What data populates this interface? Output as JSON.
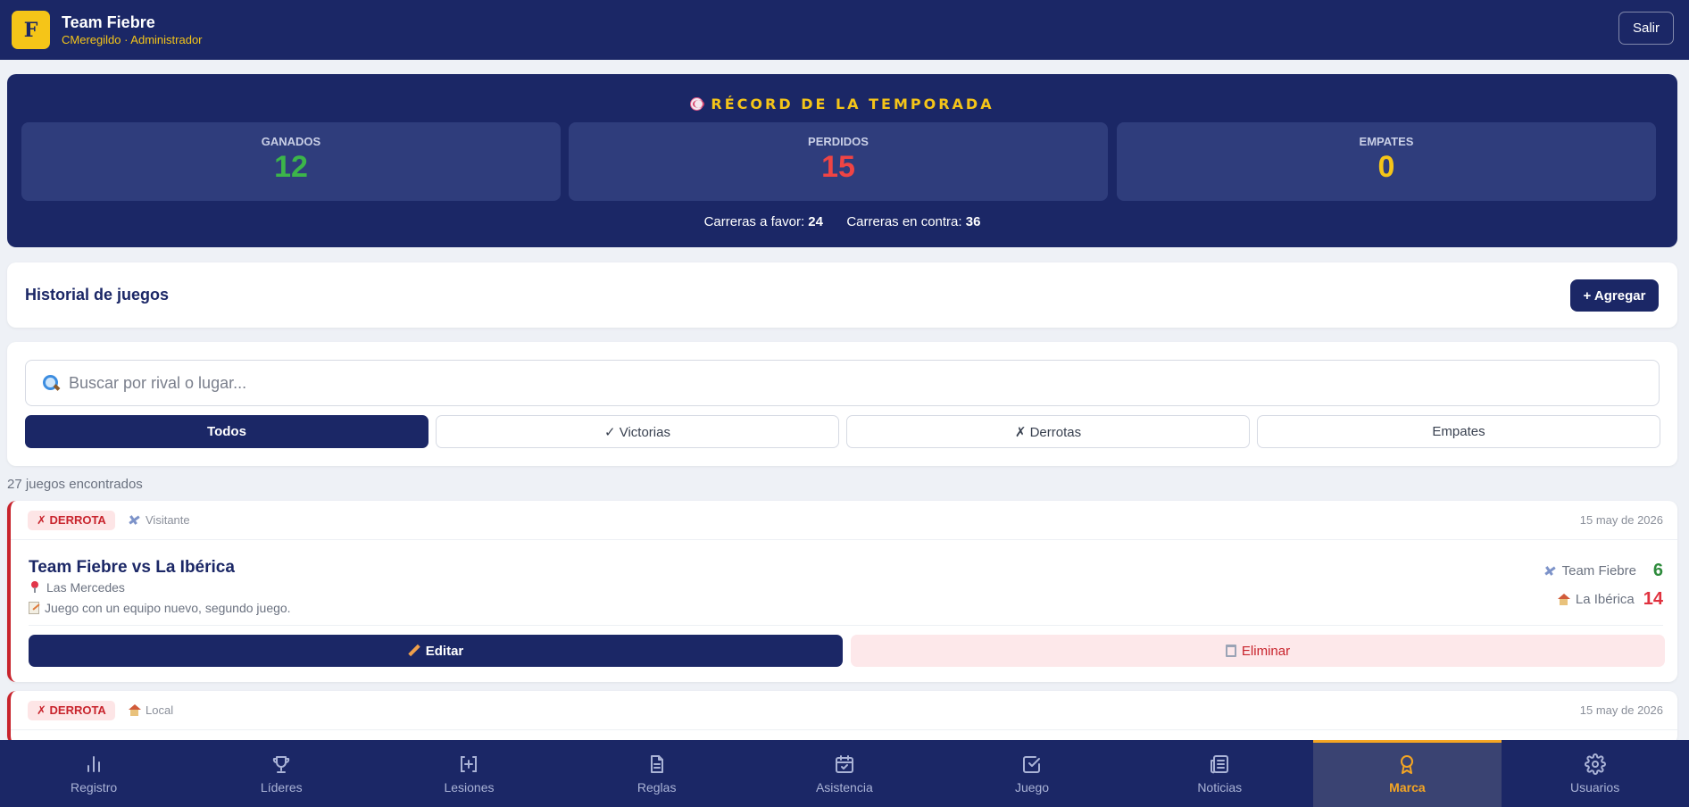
{
  "header": {
    "logo_letter": "F",
    "team_name": "Team Fiebre",
    "user_line": "CMeregildo · Administrador",
    "logout_label": "Salir"
  },
  "record": {
    "title": "RÉCORD DE LA TEMPORADA",
    "stats": [
      {
        "label": "GANADOS",
        "value": "12",
        "color": "#3cb54a"
      },
      {
        "label": "PERDIDOS",
        "value": "15",
        "color": "#ef4444"
      },
      {
        "label": "EMPATES",
        "value": "0",
        "color": "#f5c518"
      }
    ],
    "runs_for_label": "Carreras a favor:",
    "runs_for": "24",
    "runs_against_label": "Carreras en contra:",
    "runs_against": "36"
  },
  "history": {
    "title": "Historial de juegos",
    "add_label": "+ Agregar"
  },
  "filters": {
    "search_placeholder": "Buscar por rival o lugar...",
    "tabs": [
      {
        "label": "Todos",
        "active": true
      },
      {
        "label": "✓ Victorias",
        "active": false
      },
      {
        "label": "✗ Derrotas",
        "active": false
      },
      {
        "label": "Empates",
        "active": false
      }
    ]
  },
  "results_count": "27 juegos encontrados",
  "games": [
    {
      "result": "✗ DERROTA",
      "venue": "Visitante",
      "date": "15 may de 2026",
      "title": "Team Fiebre vs La Ibérica",
      "location": "Las Mercedes",
      "note": "Juego con un equipo nuevo, segundo juego.",
      "scores": [
        {
          "team": "Team Fiebre",
          "runs": "6",
          "color": "#2e8b3c",
          "icon": "plane-icon"
        },
        {
          "team": "La Ibérica",
          "runs": "14",
          "color": "#e0323f",
          "icon": "house-icon"
        }
      ],
      "edit_label": "Editar",
      "delete_label": "Eliminar"
    },
    {
      "result": "✗ DERROTA",
      "venue": "Local",
      "date": "15 may de 2026"
    }
  ],
  "nav": [
    {
      "label": "Registro",
      "icon": "bar-chart-icon",
      "active": false
    },
    {
      "label": "Líderes",
      "icon": "trophy-icon",
      "active": false
    },
    {
      "label": "Lesiones",
      "icon": "medical-plus-icon",
      "active": false
    },
    {
      "label": "Reglas",
      "icon": "document-icon",
      "active": false
    },
    {
      "label": "Asistencia",
      "icon": "calendar-check-icon",
      "active": false
    },
    {
      "label": "Juego",
      "icon": "checkbox-icon",
      "active": false
    },
    {
      "label": "Noticias",
      "icon": "newspaper-icon",
      "active": false
    },
    {
      "label": "Marca",
      "icon": "award-icon",
      "active": true
    },
    {
      "label": "Usuarios",
      "icon": "gear-icon",
      "active": false
    }
  ]
}
